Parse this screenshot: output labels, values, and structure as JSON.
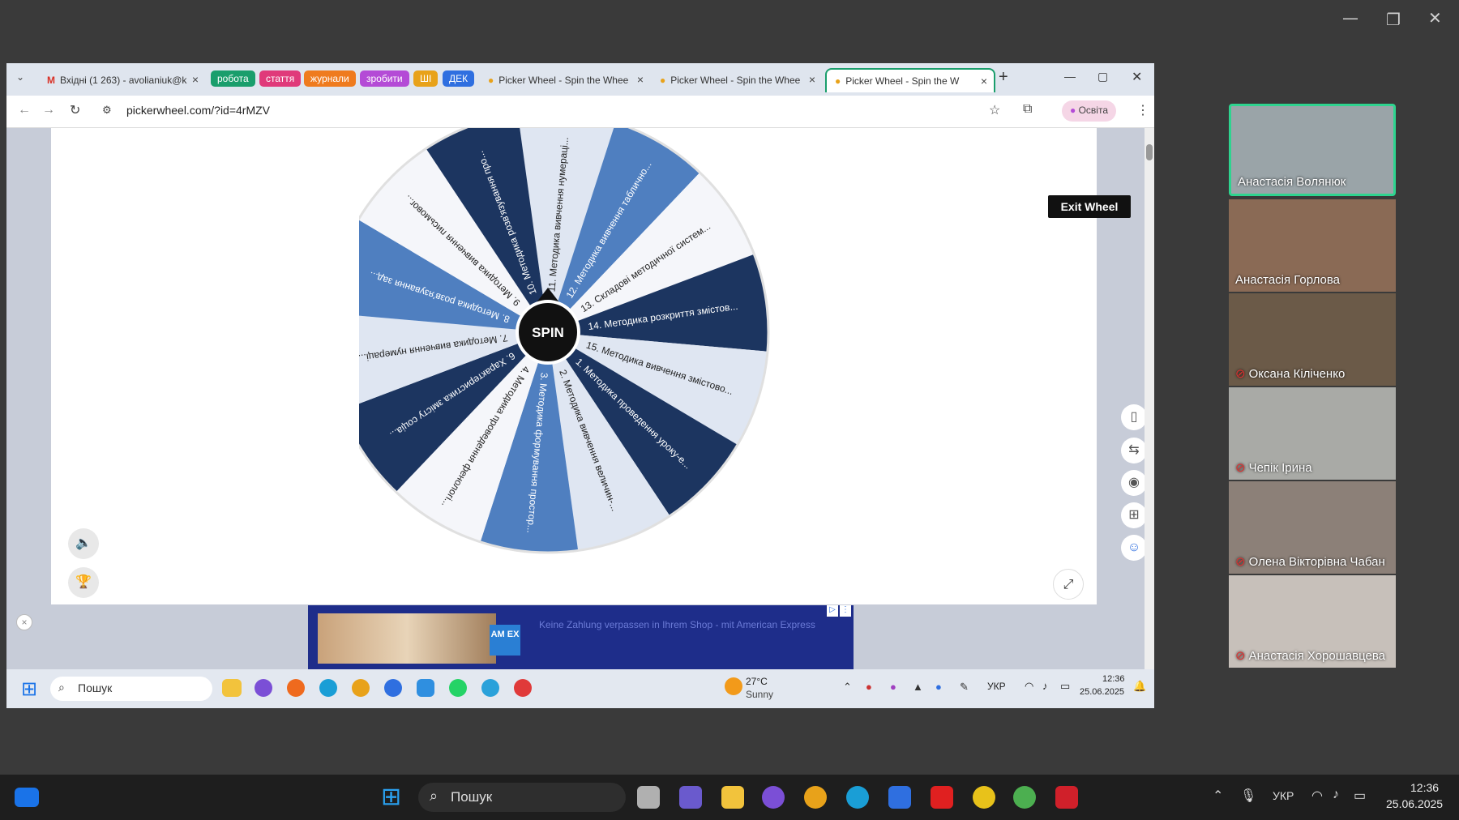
{
  "zoom_window": {
    "controls": [
      "—",
      "❐",
      "✕"
    ]
  },
  "browser": {
    "tabs": [
      {
        "label": "Вхідні (1 263) - avolianiuk@k",
        "active": false
      },
      {
        "label": "Picker Wheel - Spin the Whee",
        "active": false
      },
      {
        "label": "Picker Wheel - Spin the Whee",
        "active": false
      },
      {
        "label": "Picker Wheel - Spin the W",
        "active": true
      }
    ],
    "bookmark_chips": [
      {
        "label": "робота",
        "color": "#1a9e6c"
      },
      {
        "label": "стаття",
        "color": "#e03a7a"
      },
      {
        "label": "журнали",
        "color": "#ef7b1e"
      },
      {
        "label": "зробити",
        "color": "#b44bd6"
      },
      {
        "label": "ШІ",
        "color": "#e8a21a"
      },
      {
        "label": "ДЕК",
        "color": "#2f6fe0"
      }
    ],
    "url": "pickerwheel.com/?id=4rMZV",
    "profile_label": "Освіта"
  },
  "page": {
    "exit_button": "Exit Wheel",
    "spin_label": "SPIN",
    "wheel_items": [
      "11. Методика вивчення нумераці...",
      "12. Методика вивчення таблично...",
      "13. Складові методичної систем...",
      "14. Методика розкриття змістов...",
      "15. Методика вивчення змістово...",
      "1. Методика проведення уроку-е...",
      "2. Методика вивчення величин-...",
      "3. Методика формування простор...",
      "4. Методика проведення фенологі...",
      "6. Характеристика змісту соціа...",
      "7. Методика вивчення нумераці...",
      "8. Методика розв'язування зад...",
      "9. Методика вивчення письмовог...",
      "10. Методика розв'язування про..."
    ],
    "wheel_colors": [
      "#dfe6f2",
      "#4f7fc0",
      "#f5f6fa",
      "#1c3560",
      "#dfe6f2",
      "#1c3560",
      "#dfe6f2",
      "#4f7fc0",
      "#f5f6fa",
      "#1c3560",
      "#dfe6f2",
      "#4f7fc0",
      "#f5f6fa",
      "#1c3560"
    ],
    "ad_text": "Keine Zahlung verpassen in Ihrem Shop - mit American Express",
    "ad_logo": "AM EX"
  },
  "inner_taskbar": {
    "search_placeholder": "Пошук",
    "weather_temp": "27°C",
    "weather_desc": "Sunny",
    "lang": "УКР",
    "time": "12:36",
    "date": "25.06.2025"
  },
  "participants": [
    {
      "name": "Анастасія Волянюк",
      "muted": false,
      "active": true,
      "bg": "#9aa4a8"
    },
    {
      "name": "Анастасія Горлова",
      "muted": false,
      "active": false,
      "bg": "#8a6a55"
    },
    {
      "name": "Оксана Кіліченко",
      "muted": true,
      "active": false,
      "bg": "#6b5a48"
    },
    {
      "name": "Чепік Ірина",
      "muted": true,
      "active": false,
      "bg": "#a9aaa6"
    },
    {
      "name": "Олена Вікторівна Чабан",
      "muted": true,
      "active": false,
      "bg": "#8c8078"
    },
    {
      "name": "Анастасія Хорошавцева",
      "muted": true,
      "active": false,
      "bg": "#c7c0ba"
    }
  ],
  "outer_taskbar": {
    "search_placeholder": "Пошук",
    "lang": "УКР",
    "time": "12:36",
    "date": "25.06.2025"
  }
}
